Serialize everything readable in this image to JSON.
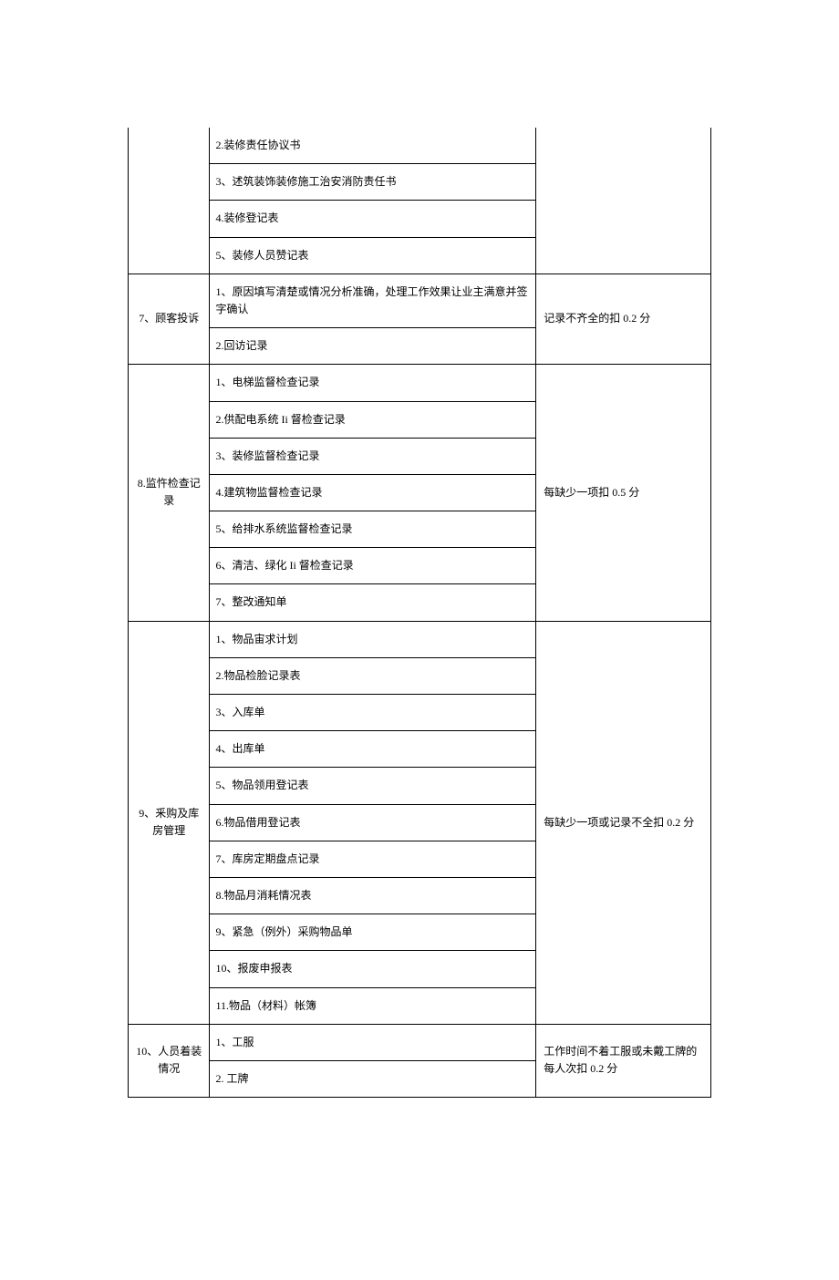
{
  "rows": [
    {
      "col1": "",
      "col2_items": [
        "2.装修责任协议书",
        "3、述筑装饰装修施工治安消防责任书",
        "4.装修登记表",
        "5、装修人员赞记表"
      ],
      "col3": "",
      "continuation": true
    },
    {
      "col1": "7、顾客投诉",
      "col2_items": [
        "1、原因填写清楚或情况分析准确，处理工作效果让业主满意并签字确认",
        "2.回访记录"
      ],
      "col3": "记录不齐全的扣 0.2 分"
    },
    {
      "col1": "8.监忤检查记录",
      "col2_items": [
        "1、电梯监督检查记录",
        "2.供配电系统 Ii 督检查记录",
        "3、装修监督检查记录",
        "4.建筑物监督检查记录",
        "5、给排水系统监督检查记录",
        "6、清洁、绿化 Ii 督检查记录",
        "7、整改通知单"
      ],
      "col3": "每缺少一项扣 0.5 分"
    },
    {
      "col1": "9、釆购及库房管理",
      "col2_items": [
        "1、物品宙求计划",
        "2.物品检脸记录表",
        "3、入库单",
        "4、出库单",
        "5、物品领用登记表",
        "6.物品借用登记表",
        "7、库房定期盘点记录",
        "8.物品月消耗情况表",
        "9、紧急（例外）采购物品单",
        "10、报废申报表",
        "11.物品（材料）帐簿"
      ],
      "col3": "每缺少一项或记录不全扣 0.2 分"
    },
    {
      "col1": "10、人员着装情况",
      "col2_items": [
        "1、工服",
        "2. 工牌"
      ],
      "col3": "工作时间不着工服或未戴工牌的每人次扣 0.2 分"
    }
  ]
}
